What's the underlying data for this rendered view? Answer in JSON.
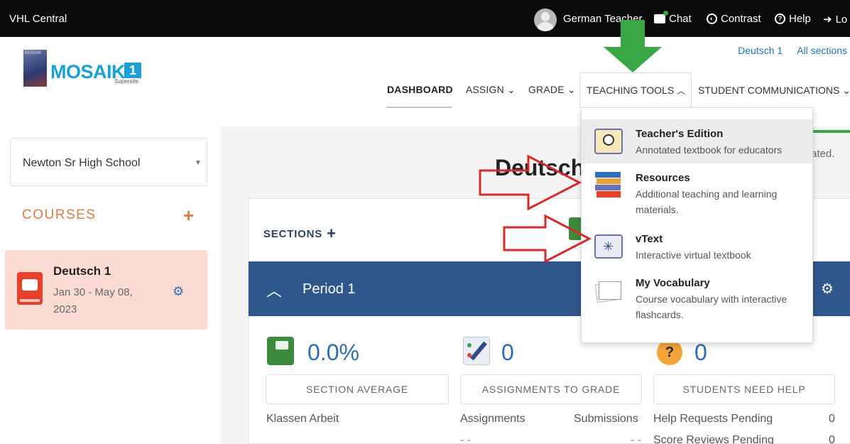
{
  "topbar": {
    "brand": "VHL Central",
    "user": "German Teacher",
    "chat": "Chat",
    "contrast": "Contrast",
    "help": "Help",
    "logout": "Lo"
  },
  "header": {
    "logo_tiny": "MOSAIK",
    "logo_word": "MOSAIK",
    "logo_num": "1",
    "logo_sup": "Supersite",
    "crumb_course": "Deutsch 1",
    "crumb_sections": "All sections"
  },
  "nav": {
    "dashboard": "DASHBOARD",
    "assign": "ASSIGN",
    "grade": "GRADE",
    "teaching_tools": "TEACHING TOOLS",
    "student_comms": "STUDENT COMMUNICATIONS"
  },
  "sidebar": {
    "school": "Newton Sr High School",
    "courses_heading": "COURSES",
    "course": {
      "name": "Deutsch 1",
      "dates": "Jan 30 - May 08, 2023"
    }
  },
  "main": {
    "title": "Deutsch",
    "alert_tail": "ated.",
    "sections_heading": "SECTIONS",
    "period": "Period 1",
    "stats": {
      "section_average": "0.0%",
      "assignments_to_grade": "0",
      "students_need_help": "0"
    },
    "buttons": {
      "section_average": "SECTION AVERAGE",
      "assignments_to_grade": "ASSIGNMENTS TO GRADE",
      "students_need_help": "STUDENTS NEED HELP"
    },
    "rows": {
      "klassen": "Klassen Arbeit",
      "assignments": "Assignments",
      "submissions": "Submissions",
      "help_pending": "Help Requests Pending",
      "help_pending_val": "0",
      "dashes_1": "- -",
      "dashes_2": "- -",
      "score_pending": "Score Reviews Pending",
      "score_pending_val": "0"
    }
  },
  "dropdown": {
    "items": [
      {
        "title": "Teacher's Edition",
        "desc": "Annotated textbook for educators"
      },
      {
        "title": "Resources",
        "desc": "Additional teaching and learning materials."
      },
      {
        "title": "vText",
        "desc": "Interactive virtual textbook"
      },
      {
        "title": "My Vocabulary",
        "desc": "Course vocabulary with interactive flashcards."
      }
    ]
  },
  "colors": {
    "accent_orange": "#e07b4b",
    "period_blue": "#2f578c",
    "link_blue": "#2873b8",
    "annotation_green": "#3aa744",
    "annotation_red": "#d62b2b"
  }
}
